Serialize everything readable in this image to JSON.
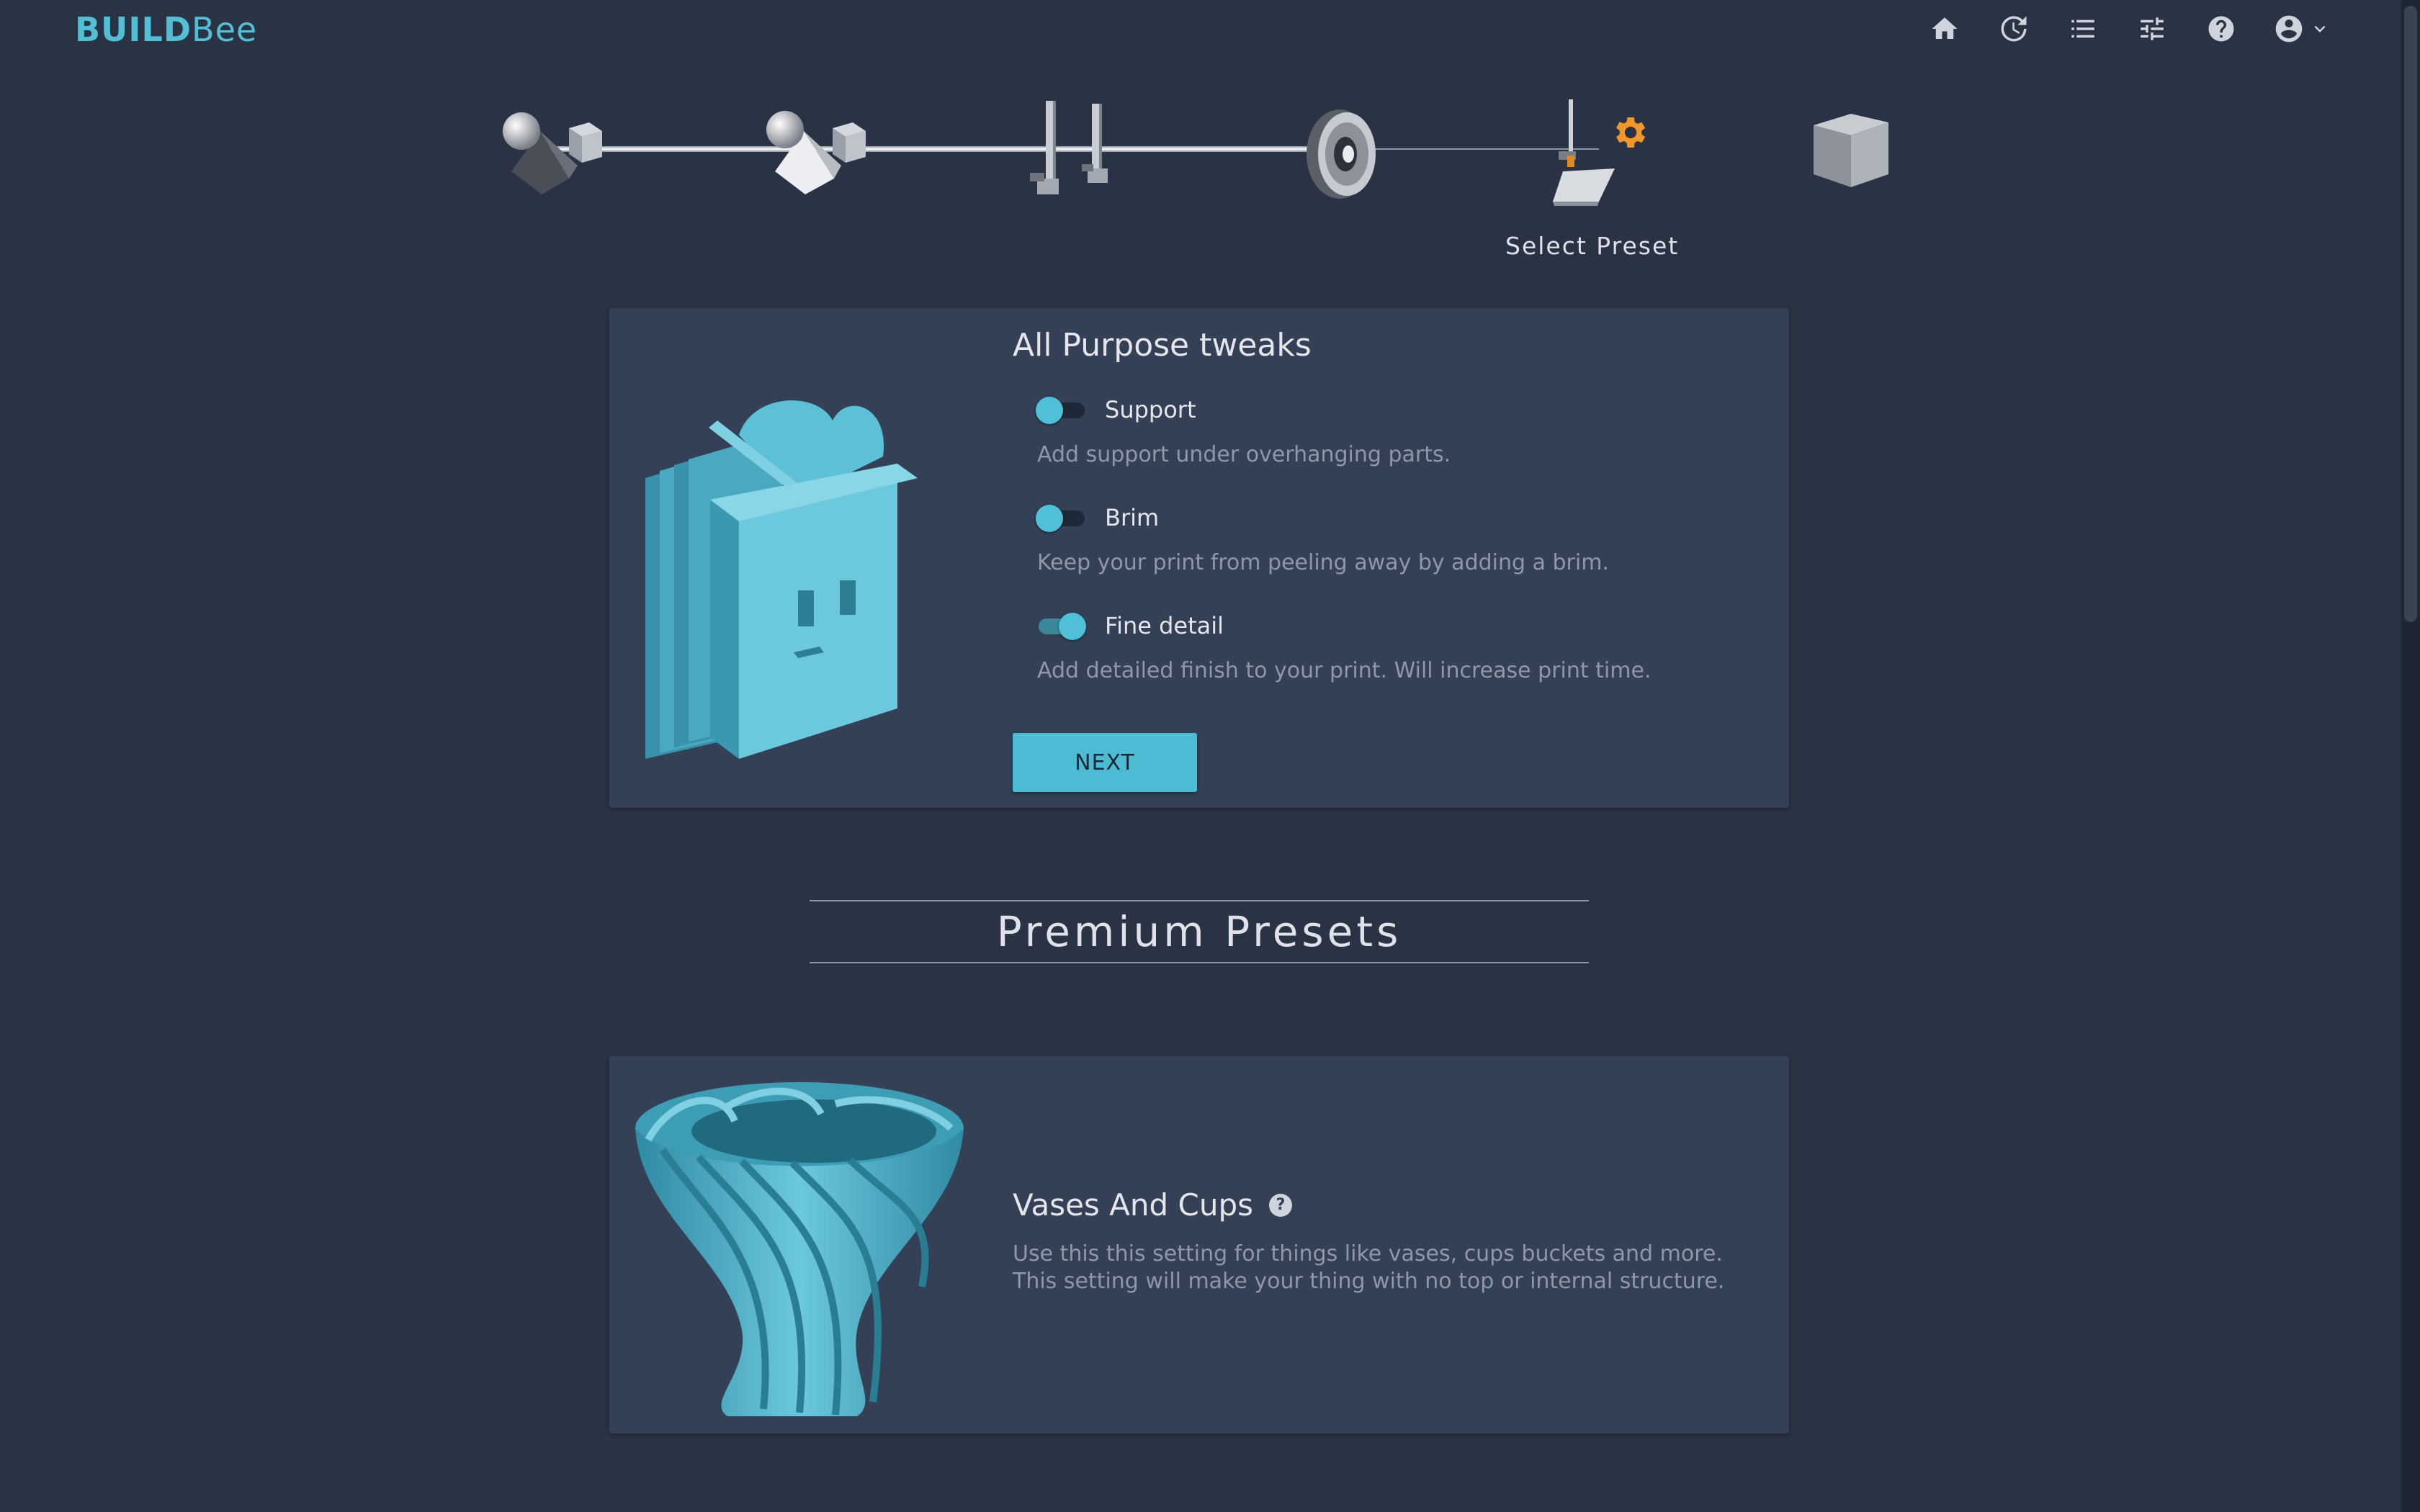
{
  "header": {
    "logo_part1": "BUILD",
    "logo_part2": "Bee",
    "icons": [
      "home-icon",
      "history-icon",
      "queue-list-icon",
      "settings-sliders-icon",
      "help-icon",
      "account-icon"
    ]
  },
  "steps": {
    "current_label": "Select Preset",
    "items": [
      "add-model",
      "model-prep",
      "printer",
      "filament",
      "select-preset",
      "output"
    ],
    "current_index": 4
  },
  "tweaks": {
    "title": "All Purpose tweaks",
    "options": [
      {
        "label": "Support",
        "description": "Add support under overhanging parts.",
        "enabled": false
      },
      {
        "label": "Brim",
        "description": "Keep your print from peeling away by adding a brim.",
        "enabled": false
      },
      {
        "label": "Fine detail",
        "description": "Add detailed finish to your print. Will increase print time.",
        "enabled": true
      }
    ],
    "next_label": "NEXT"
  },
  "premium": {
    "heading": "Premium Presets",
    "items": [
      {
        "title": "Vases And Cups",
        "help_glyph": "?",
        "description": "Use this this setting for things like vases, cups buckets and more. This setting will make your thing with no top or internal structure."
      }
    ]
  },
  "colors": {
    "background": "#2a3344",
    "card": "#334055",
    "accent": "#4cbcd4",
    "gear": "#f0962a"
  }
}
